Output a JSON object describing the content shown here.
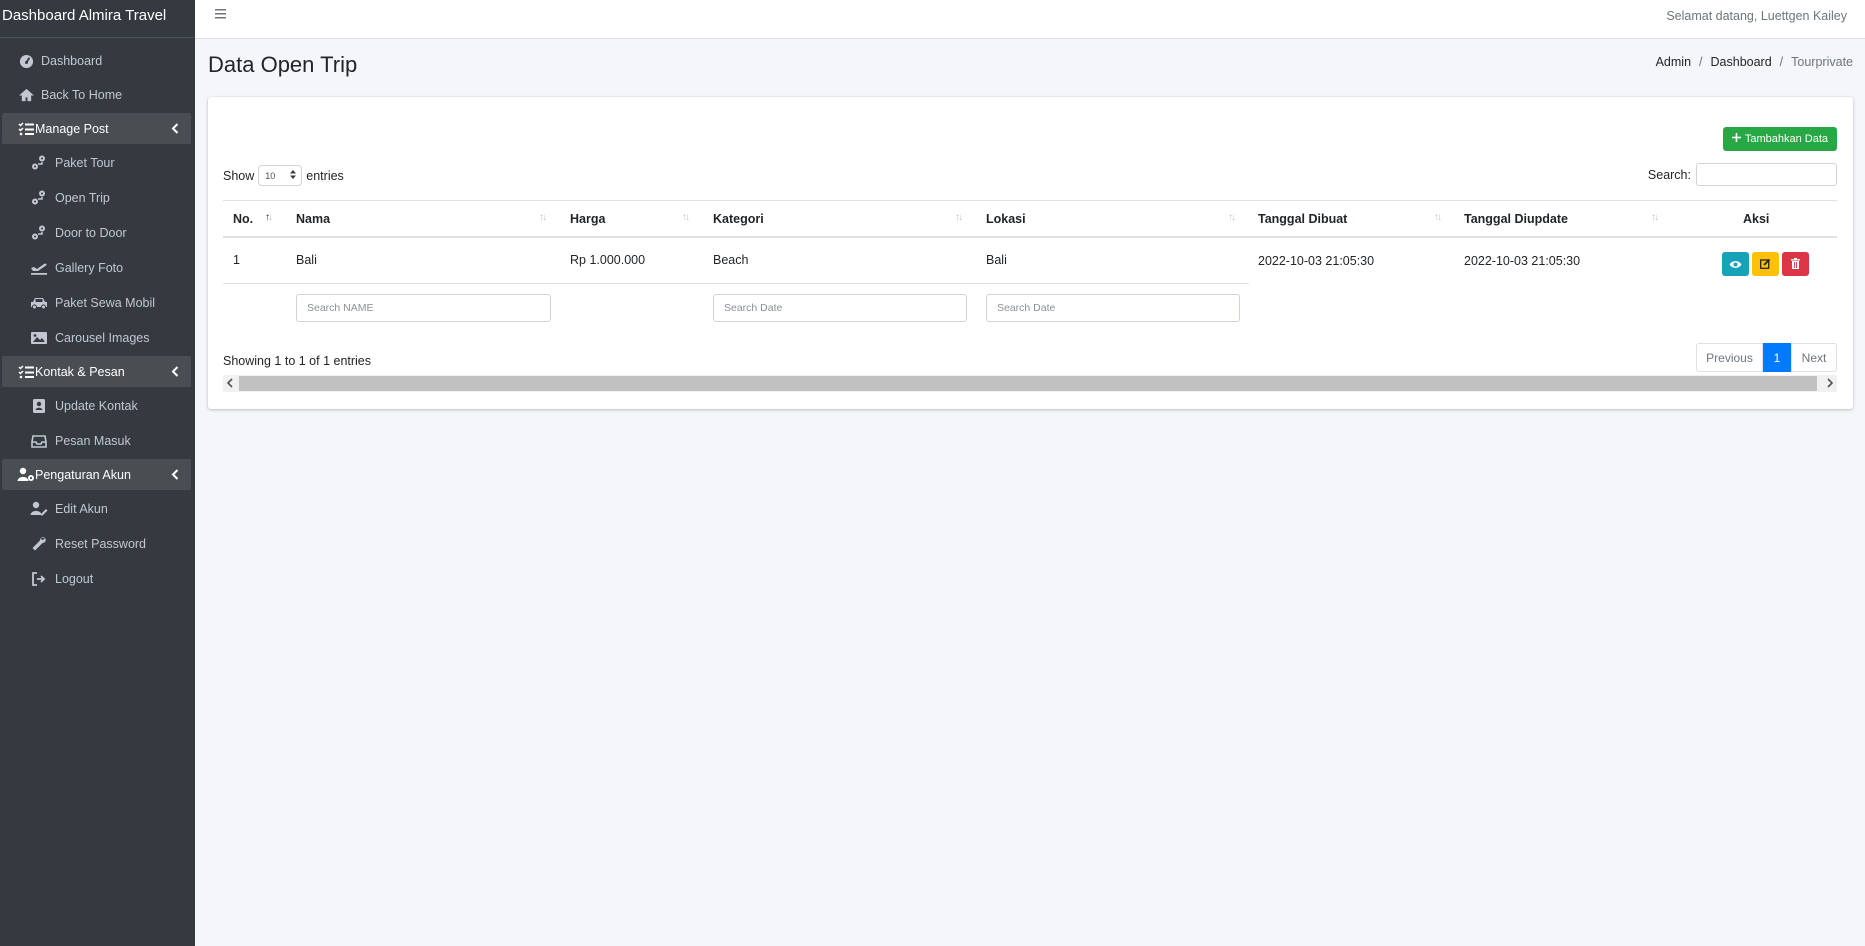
{
  "brand": "Dashboard Almira Travel",
  "topbar": {
    "welcome": "Selamat datang, Luettgen Kailey"
  },
  "sidebar": {
    "dashboard": "Dashboard",
    "back_home": "Back To Home",
    "manage_post": "Manage Post",
    "paket_tour": "Paket Tour",
    "open_trip": "Open Trip",
    "door_to_door": "Door to Door",
    "gallery_foto": "Gallery Foto",
    "paket_sewa_mobil": "Paket Sewa Mobil",
    "carousel_images": "Carousel Images",
    "kontak_pesan": "Kontak & Pesan",
    "update_kontak": "Update Kontak",
    "pesan_masuk": "Pesan Masuk",
    "pengaturan_akun": "Pengaturan Akun",
    "edit_akun": "Edit Akun",
    "reset_password": "Reset Password",
    "logout": "Logout"
  },
  "page": {
    "title": "Data Open Trip",
    "breadcrumb": [
      "Admin",
      "Dashboard",
      "Tourprivate"
    ]
  },
  "card": {
    "add_button": "Tambahkan Data",
    "show_label": "Show",
    "entries_value": "10",
    "entries_label": "entries",
    "search_label": "Search:",
    "search_value": ""
  },
  "table": {
    "columns": [
      "No.",
      "Nama",
      "Harga",
      "Kategori",
      "Lokasi",
      "Tanggal Dibuat",
      "Tanggal Diupdate",
      "Aksi"
    ],
    "rows": [
      {
        "no": "1",
        "nama": "Bali",
        "harga": "Rp 1.000.000",
        "kategori": "Beach",
        "lokasi": "Bali",
        "dibuat": "2022-10-03 21:05:30",
        "diupdate": "2022-10-03 21:05:30"
      }
    ],
    "filters": {
      "nama": "Search NAME",
      "kategori": "Search Date",
      "lokasi": "Search Date"
    }
  },
  "footer": {
    "info": "Showing 1 to 1 of 1 entries",
    "prev": "Previous",
    "current": "1",
    "next": "Next"
  }
}
